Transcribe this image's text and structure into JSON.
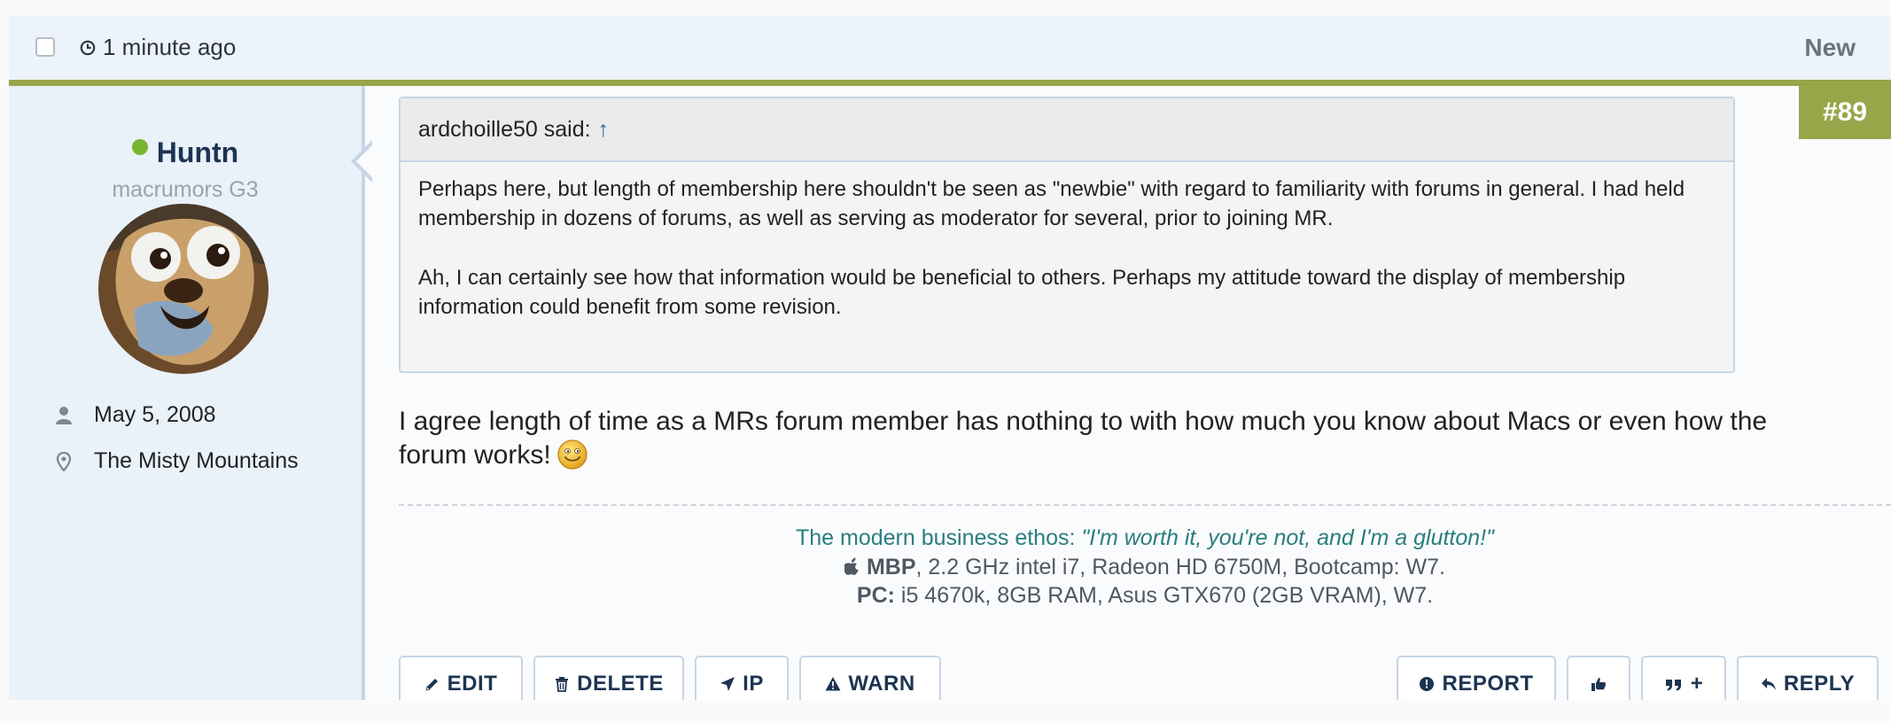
{
  "header": {
    "timestamp": "1 minute ago",
    "new_label": "New"
  },
  "user": {
    "name": "Huntn",
    "title": "macrumors G3",
    "joined": "May 5, 2008",
    "location": "The Misty Mountains",
    "online_color": "#78b52e"
  },
  "post": {
    "number": "#89",
    "quote_author": "ardchoille50 said:",
    "quote_arrow": "↑",
    "quote_p1": "Perhaps here, but length of membership here shouldn't be seen as \"newbie\" with regard to familiarity with forums in general. I had held membership in dozens of forums, as well as serving as moderator for several, prior to joining MR.",
    "quote_p2": "Ah, I can certainly see how that information would be beneficial to others. Perhaps my attitude toward the display of membership information could benefit from some revision.",
    "message": "I agree length of time as a MRs forum member has nothing to with how much you know about Macs or even how the forum works!"
  },
  "signature": {
    "line1_prefix": "The modern business ethos: ",
    "line1_quote": "\"I'm worth it, you're not, and I'm a glutton!\"",
    "line2_label": "MBP",
    "line2_text": ", 2.2 GHz intel i7, Radeon HD 6750M, Bootcamp: W7.",
    "line3_label": "PC:",
    "line3_text": " i5 4670k, 8GB RAM, Asus GTX670 (2GB VRAM), W7."
  },
  "actions": {
    "edit": "EDIT",
    "delete": "DELETE",
    "ip": "IP",
    "warn": "WARN",
    "report": "REPORT",
    "multiquote": "+",
    "reply": "REPLY"
  },
  "colors": {
    "accent_green": "#98a64a",
    "navy": "#1d3452",
    "header_bg": "#edf3fa",
    "sidebar_bg": "#e9f1f9"
  }
}
